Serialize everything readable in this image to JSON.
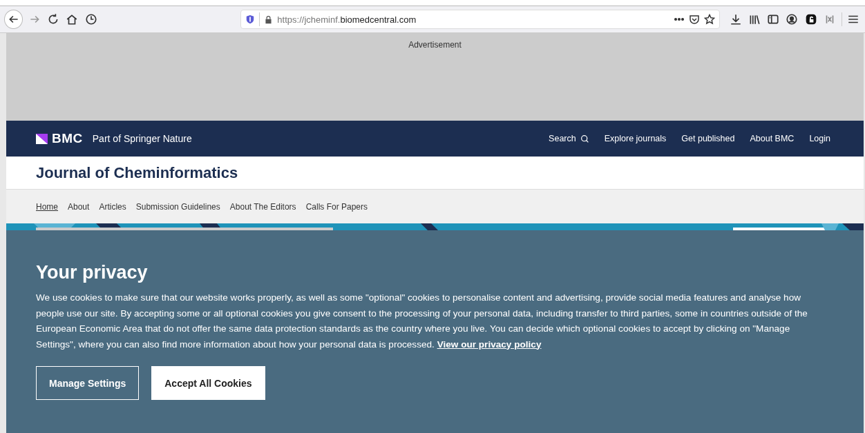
{
  "browser": {
    "url_host_prefix": "https://jcheminf.",
    "url_host": "biomedcentral.com"
  },
  "advertisement": {
    "label": "Advertisement"
  },
  "header": {
    "brand": "BMC",
    "tagline": "Part of Springer Nature",
    "links": [
      {
        "label": "Search",
        "kind": "search"
      },
      {
        "label": "Explore journals",
        "kind": "link"
      },
      {
        "label": "Get published",
        "kind": "link"
      },
      {
        "label": "About BMC",
        "kind": "link"
      },
      {
        "label": "Login",
        "kind": "link"
      }
    ]
  },
  "journal": {
    "title": "Journal of Cheminformatics"
  },
  "nav": [
    {
      "label": "Home",
      "selected": true
    },
    {
      "label": "About",
      "selected": false
    },
    {
      "label": "Articles",
      "selected": false
    },
    {
      "label": "Submission Guidelines",
      "selected": false
    },
    {
      "label": "About The Editors",
      "selected": false
    },
    {
      "label": "Calls For Papers",
      "selected": false
    }
  ],
  "cookie_banner": {
    "title": "Your privacy",
    "text": "We use cookies to make sure that our website works properly, as well as some \"optional\" cookies to personalise content and advertising, provide social media features and analyse how people use our site. By accepting some or all optional cookies you give consent to the processing of your personal data, including transfer to third parties, some in countries outside of the European Economic Area that do not offer the same data protection standards as the country where you live. You can decide which optional cookies to accept by clicking on \"Manage Settings\", where you can also find more information about how your personal data is processed.",
    "link": "View our privacy policy",
    "buttons": [
      {
        "label": "Manage Settings",
        "kind": "outline"
      },
      {
        "label": "Accept All Cookies",
        "kind": "solid"
      }
    ]
  }
}
